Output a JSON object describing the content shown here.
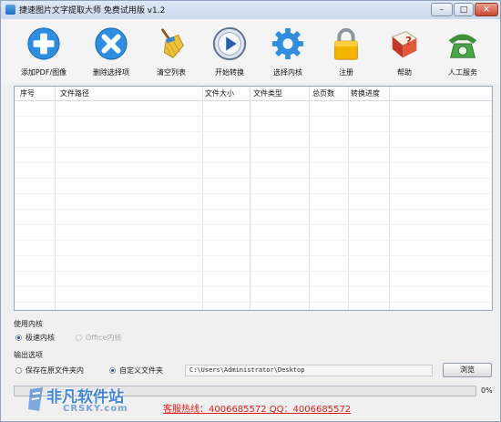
{
  "window": {
    "title": "捷速图片文字提取大师 免费试用版 v1.2",
    "min_glyph": "–",
    "max_glyph": "□",
    "close_glyph": "✕"
  },
  "toolbar": [
    {
      "key": "add",
      "label": "添加PDF/图像",
      "icon": "add-icon"
    },
    {
      "key": "delete",
      "label": "删除选择项",
      "icon": "delete-icon"
    },
    {
      "key": "clear",
      "label": "清空列表",
      "icon": "broom-icon"
    },
    {
      "key": "start",
      "label": "开始转换",
      "icon": "play-icon"
    },
    {
      "key": "engine",
      "label": "选择内核",
      "icon": "gear-icon"
    },
    {
      "key": "register",
      "label": "注册",
      "icon": "lock-icon"
    },
    {
      "key": "help",
      "label": "帮助",
      "icon": "help-book-icon"
    },
    {
      "key": "service",
      "label": "人工服务",
      "icon": "phone-icon"
    }
  ],
  "table": {
    "columns": [
      "序号",
      "文件路径",
      "文件大小",
      "文件类型",
      "总页数",
      "转换进度"
    ],
    "rows": []
  },
  "engine": {
    "section_label": "使用内核",
    "options": [
      {
        "label": "极速内核",
        "selected": true
      },
      {
        "label": "Office内核",
        "selected": false
      }
    ]
  },
  "output": {
    "section_label": "输出选项",
    "options": [
      {
        "label": "保存在原文件夹内",
        "selected": false
      },
      {
        "label": "自定义文件夹",
        "selected": true
      }
    ],
    "path": "C:\\Users\\Administrator\\Desktop",
    "browse_label": "浏览"
  },
  "progress": {
    "value": 0,
    "text": "0%"
  },
  "status": {
    "hotline": "客服热线：4006685572 QQ：4006685572"
  },
  "watermark": {
    "main": "非凡软件站",
    "sub": "CRSKY.com"
  },
  "colors": {
    "accent": "#2f8ee0",
    "hotline": "#e02020",
    "progress_fill": "#7ecb5a"
  }
}
